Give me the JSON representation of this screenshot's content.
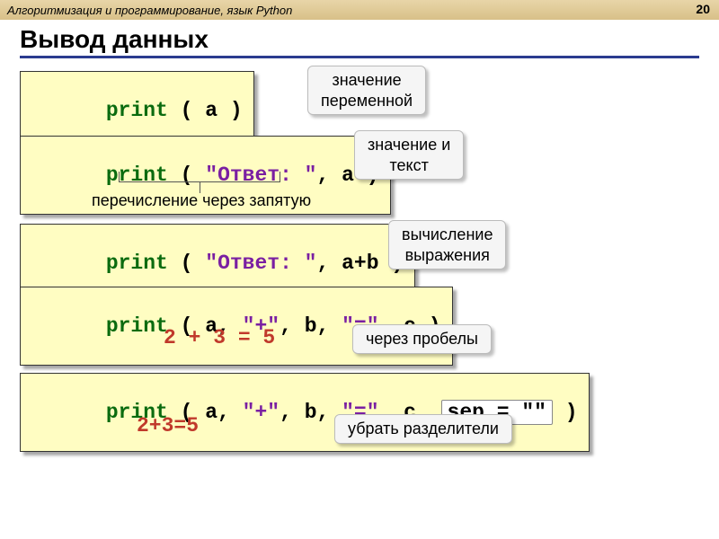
{
  "header": {
    "title": "Алгоритмизация и программирование, язык Python",
    "page": "20"
  },
  "heading": "Вывод данных",
  "rows": {
    "r1": {
      "kw": "print",
      "code": " ( a )",
      "note": "значение\nпеременной"
    },
    "r2": {
      "kw": "print",
      "pre": " ( ",
      "str": "\"Ответ: \"",
      "post": ", a )",
      "note": "значение и\nтекст",
      "caption": "перечисление через запятую"
    },
    "r3": {
      "kw": "print",
      "pre": " ( ",
      "str": "\"Ответ: \"",
      "post": ", a+b )",
      "note": "вычисление\nвыражения"
    },
    "r4": {
      "kw": "print",
      "pre": " ( a, ",
      "s1": "\"+\"",
      "m1": ", b, ",
      "s2": "\"=\"",
      "post": ", c )",
      "output": "2 + 3 = 5",
      "note": "через пробелы"
    },
    "r5": {
      "kw": "print",
      "pre": " ( a, ",
      "s1": "\"+\"",
      "m1": ", b, ",
      "s2": "\"=\"",
      "m2": ", c, ",
      "sep": "sep = \"\"",
      "post": " )",
      "output": "2+3=5",
      "note": "убрать разделители"
    }
  }
}
